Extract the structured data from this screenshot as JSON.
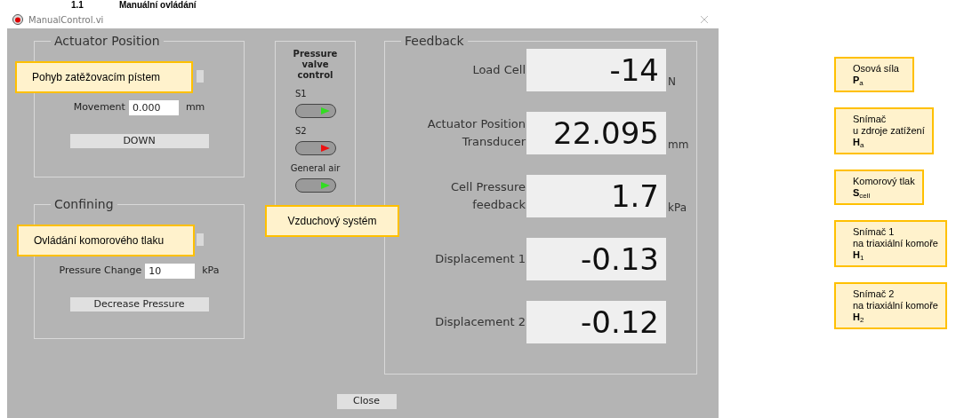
{
  "heading": {
    "number": "1.1",
    "title": "Manuální ovládání"
  },
  "window": {
    "title": "ManualControl.vi",
    "actuator_position": {
      "title": "Actuator Position",
      "field_label": "Movement",
      "field_value": "0.000",
      "unit": "mm",
      "button": "DOWN"
    },
    "confining": {
      "title": "Confining",
      "field_label": "Pressure Change",
      "field_value": "10",
      "unit": "kPa",
      "button": "Decrease Pressure"
    },
    "valves": {
      "title": "Pressure valve control",
      "items": [
        {
          "label": "S1",
          "color": "#33dd22"
        },
        {
          "label": "S2",
          "color": "#ee1111"
        },
        {
          "label": "General air",
          "color": "#33dd22"
        }
      ]
    },
    "feedback": {
      "title": "Feedback",
      "rows": [
        {
          "label_lines": [
            "Load Cell"
          ],
          "value": "-14",
          "unit": "N"
        },
        {
          "label_lines": [
            "Actuator Position",
            "Transducer"
          ],
          "value": "22.095",
          "unit": "mm"
        },
        {
          "label_lines": [
            "Cell Pressure",
            "feedback"
          ],
          "value": "1.7",
          "unit": "kPa"
        },
        {
          "label_lines": [
            "Displacement 1"
          ],
          "value": "-0.13"
        },
        {
          "label_lines": [
            "Displacement 2"
          ],
          "value": "-0.12"
        }
      ]
    },
    "close_button": "Close"
  },
  "callouts": [
    "Pohyb zatěžovacím pístem",
    "Ovládání komorového tlaku",
    "Vzduchový systém"
  ],
  "side_notes": [
    {
      "lines": [
        "Osová síla"
      ],
      "symbol": "**P**$_{a}$"
    },
    {
      "lines": [
        "Snímač",
        "u zdroje zatížení"
      ],
      "symbol": "**H**$_{a}$"
    },
    {
      "lines": [
        "Komorový tlak"
      ],
      "symbol": "**S**$_{cell}$"
    },
    {
      "lines": [
        "Snímač 1",
        "na triaxiální komoře"
      ],
      "symbol": "**H**$_{1}$"
    },
    {
      "lines": [
        "Snímač 2",
        "na triaxiální komoře"
      ],
      "symbol": "**H**$_{2}$"
    }
  ]
}
